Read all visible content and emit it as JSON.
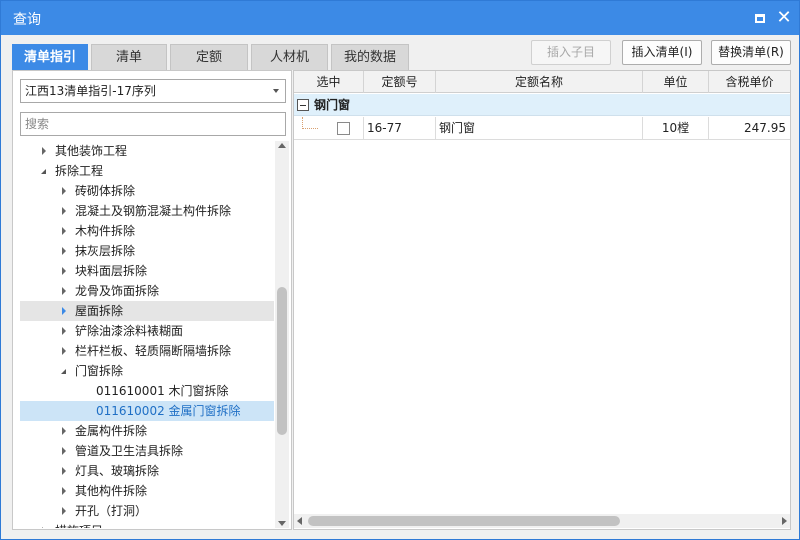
{
  "window": {
    "title": "查询"
  },
  "tabs": [
    {
      "label": "清单指引",
      "active": true
    },
    {
      "label": "清单",
      "active": false
    },
    {
      "label": "定额",
      "active": false
    },
    {
      "label": "人材机",
      "active": false
    },
    {
      "label": "我的数据",
      "active": false
    }
  ],
  "toolbar": {
    "insert_child": "插入子目",
    "insert_list": "插入清单(I)",
    "replace_list": "替换清单(R)"
  },
  "left": {
    "combo_value": "江西13清单指引-17序列",
    "search_placeholder": "搜索",
    "tree": [
      {
        "label": "其他装饰工程",
        "level": 1,
        "state": "collapsed"
      },
      {
        "label": "拆除工程",
        "level": 1,
        "state": "expanded"
      },
      {
        "label": "砖砌体拆除",
        "level": 2,
        "state": "collapsed"
      },
      {
        "label": "混凝土及钢筋混凝土构件拆除",
        "level": 2,
        "state": "collapsed"
      },
      {
        "label": "木构件拆除",
        "level": 2,
        "state": "collapsed"
      },
      {
        "label": "抹灰层拆除",
        "level": 2,
        "state": "collapsed"
      },
      {
        "label": "块料面层拆除",
        "level": 2,
        "state": "collapsed"
      },
      {
        "label": "龙骨及饰面拆除",
        "level": 2,
        "state": "collapsed"
      },
      {
        "label": "屋面拆除",
        "level": 2,
        "state": "collapsed",
        "hover": true
      },
      {
        "label": "铲除油漆涂料裱糊面",
        "level": 2,
        "state": "collapsed"
      },
      {
        "label": "栏杆栏板、轻质隔断隔墙拆除",
        "level": 2,
        "state": "collapsed"
      },
      {
        "label": "门窗拆除",
        "level": 2,
        "state": "expanded"
      },
      {
        "label": "011610001  木门窗拆除",
        "level": 3,
        "state": "leaf"
      },
      {
        "label": "011610002  金属门窗拆除",
        "level": 3,
        "state": "leaf",
        "selected": true
      },
      {
        "label": "金属构件拆除",
        "level": 2,
        "state": "collapsed"
      },
      {
        "label": "管道及卫生洁具拆除",
        "level": 2,
        "state": "collapsed"
      },
      {
        "label": "灯具、玻璃拆除",
        "level": 2,
        "state": "collapsed"
      },
      {
        "label": "其他构件拆除",
        "level": 2,
        "state": "collapsed"
      },
      {
        "label": "开孔（打洞）",
        "level": 2,
        "state": "collapsed"
      },
      {
        "label": "措施项目",
        "level": 1,
        "state": "collapsed"
      }
    ]
  },
  "right": {
    "columns": [
      "选中",
      "定额号",
      "定额名称",
      "单位",
      "含税单价"
    ],
    "group": "钢门窗",
    "rows": [
      {
        "checked": false,
        "code": "16-77",
        "name": "钢门窗",
        "unit": "10樘",
        "price": "247.95"
      }
    ]
  },
  "colors": {
    "accent": "#3c8ae6",
    "selected_bg": "#cce4f7",
    "group_bg": "#dff0fb"
  }
}
